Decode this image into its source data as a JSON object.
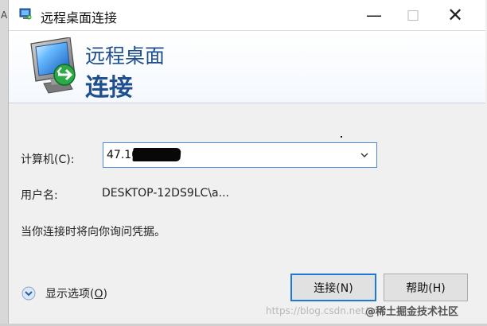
{
  "background_window": {
    "edge_char": "A"
  },
  "window": {
    "title": "远程桌面连接",
    "controls": {
      "minimize": "—",
      "maximize": "□",
      "close": "✕"
    },
    "accent_color": "#1f4f8f",
    "button_focus_color": "#1f78d1"
  },
  "banner": {
    "title": "远程桌面",
    "subtitle": "连接",
    "icon": "remote-desktop-monitor-icon"
  },
  "form": {
    "computer": {
      "label": "计算机(C):",
      "value": "47.10",
      "dropdown_icon": "chevron-down-icon"
    },
    "username": {
      "label": "用户名:",
      "value": "DESKTOP-12DS9LC\\a..."
    },
    "credential_note": "当你连接时将向你询问凭据。"
  },
  "buttons": {
    "show_options_prefix": "显示选项(",
    "show_options_hotkey": "O",
    "show_options_suffix": ")",
    "connect": "连接(N)",
    "help": "帮助(H)"
  },
  "watermark": {
    "url": "https://blog.csdn.net/w",
    "brand": "@稀土掘金技术社区"
  }
}
